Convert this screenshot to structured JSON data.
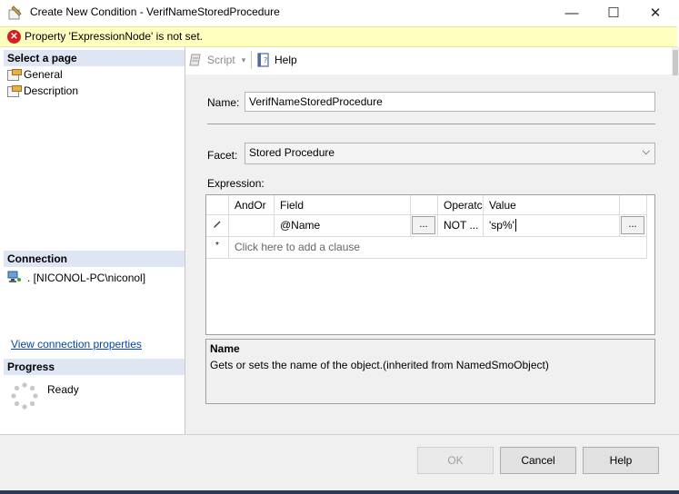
{
  "window": {
    "title": "Create New Condition - VerifNameStoredProcedure",
    "controls": {
      "minimize": "—",
      "maximize": "☐",
      "close": "✕"
    }
  },
  "warning": {
    "icon": "error-icon",
    "text": "Property 'ExpressionNode' is not set."
  },
  "left_panel": {
    "select_page_header": "Select a page",
    "pages": [
      {
        "label": "General",
        "icon": "page-wrench-icon"
      },
      {
        "label": "Description",
        "icon": "page-wrench-icon"
      }
    ],
    "connection_header": "Connection",
    "connection_text": ". [NICONOL-PC\\niconol]",
    "connection_link": "View connection properties",
    "progress_header": "Progress",
    "progress_status": "Ready"
  },
  "toolbar": {
    "script_label": "Script",
    "help_label": "Help"
  },
  "form": {
    "name_label": "Name:",
    "name_value": "VerifNameStoredProcedure",
    "facet_label": "Facet:",
    "facet_value": "Stored Procedure",
    "expression_label": "Expression:"
  },
  "grid": {
    "headers": {
      "andor": "AndOr",
      "field": "Field",
      "operator": "Operatc",
      "value": "Value"
    },
    "rows": [
      {
        "andor": "",
        "field": "@Name",
        "operator": "NOT ...",
        "value": "'sp%'"
      }
    ],
    "new_row_marker": "*",
    "add_clause_text": "Click here to add a clause",
    "ellipsis": "..."
  },
  "description": {
    "title": "Name",
    "text": "Gets or sets the name of the object.(inherited from NamedSmoObject)"
  },
  "buttons": {
    "ok": "OK",
    "cancel": "Cancel",
    "help": "Help"
  },
  "colors": {
    "section_header": "#dde6f2",
    "warning_bg": "#ffffc0",
    "link": "#0645ad",
    "error_icon": "#d62020"
  }
}
